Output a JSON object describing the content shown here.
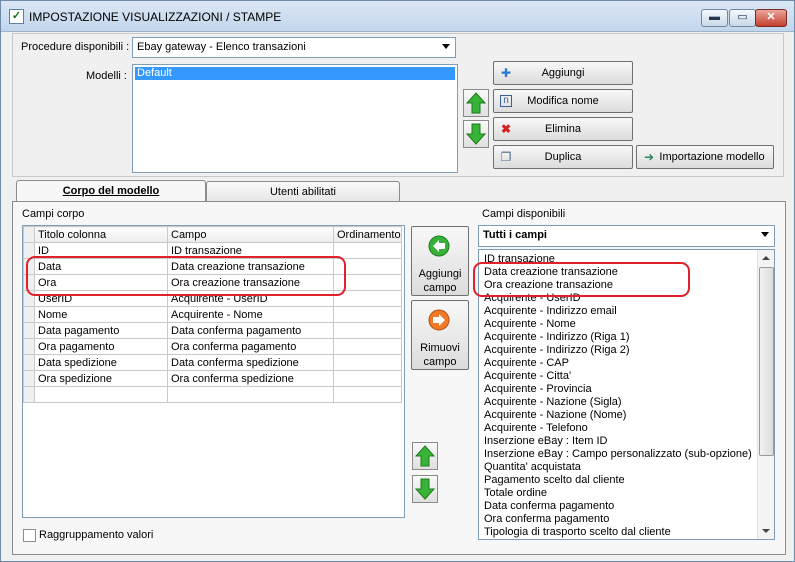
{
  "window": {
    "title": "IMPOSTAZIONE VISUALIZZAZIONI / STAMPE",
    "minimize_glyph": "▬",
    "maximize_glyph": "▭",
    "close_glyph": "✕"
  },
  "top": {
    "procedure_label": "Procedure disponibili :",
    "procedure_value": "Ebay gateway - Elenco transazioni",
    "models_label": "Modelli :",
    "models": [
      "Default"
    ],
    "buttons": {
      "add": "Aggiungi",
      "rename": "Modifica nome",
      "delete": "Elimina",
      "duplicate": "Duplica",
      "import": "Importazione modello"
    }
  },
  "tabs": [
    "Corpo del modello",
    "Utenti abilitati"
  ],
  "body": {
    "fields_label": "Campi corpo",
    "columns": [
      "Titolo colonna",
      "Campo",
      "Ordinamento"
    ],
    "rows": [
      [
        "ID",
        "ID transazione",
        ""
      ],
      [
        "Data",
        "Data creazione transazione",
        ""
      ],
      [
        "Ora",
        "Ora creazione transazione",
        ""
      ],
      [
        "UserID",
        "Acquirente - UserID",
        ""
      ],
      [
        "Nome",
        "Acquirente - Nome",
        ""
      ],
      [
        "Data pagamento",
        "Data conferma pagamento",
        ""
      ],
      [
        "Ora pagamento",
        "Ora conferma pagamento",
        ""
      ],
      [
        "Data spedizione",
        "Data conferma spedizione",
        ""
      ],
      [
        "Ora spedizione",
        "Ora conferma spedizione",
        ""
      ],
      [
        "",
        "",
        ""
      ]
    ],
    "add_field": "Aggiungi campo",
    "remove_field": "Rimuovi campo",
    "grouping_label": "Raggruppamento valori",
    "grouping_checked": false
  },
  "available": {
    "label": "Campi disponibili",
    "filter_value": "Tutti i campi",
    "items": [
      "ID transazione",
      "Data creazione transazione",
      "Ora creazione transazione",
      "Acquirente - UserID",
      "Acquirente - Indirizzo email",
      "Acquirente - Nome",
      "Acquirente - Indirizzo (Riga 1)",
      "Acquirente - Indirizzo (Riga 2)",
      "Acquirente - CAP",
      "Acquirente - Citta'",
      "Acquirente - Provincia",
      "Acquirente - Nazione (Sigla)",
      "Acquirente - Nazione (Nome)",
      "Acquirente - Telefono",
      "Inserzione eBay : Item ID",
      "Inserzione eBay : Campo personalizzato (sub-opzione)",
      "Quantita' acquistata",
      "Pagamento scelto dal cliente",
      "Totale ordine",
      "Data conferma pagamento",
      "Ora conferma pagamento",
      "Tipologia di trasporto scelto dal cliente"
    ]
  },
  "colors": {
    "highlight_annotation": "#e0202a",
    "selection": "#3399ff",
    "arrow_green": "#2fa82f",
    "remove_orange": "#f07020"
  }
}
